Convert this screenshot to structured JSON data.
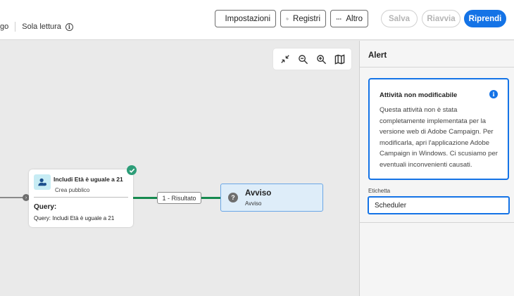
{
  "header": {
    "left_fragment": "go",
    "read_only_label": "Sola lettura",
    "info_icon": "info-icon",
    "settings_label": "Impostazioni",
    "logs_label": "Registri",
    "more_label": "Altro",
    "save_label": "Salva",
    "restart_label": "Riavvia",
    "resume_label": "Riprendi"
  },
  "zoom_toolbar": {
    "icons": [
      "collapse-icon",
      "zoom-out-icon",
      "zoom-in-icon",
      "map-icon"
    ]
  },
  "workflow": {
    "audience_node": {
      "title": "Includi Età è uguale a 21",
      "subtitle": "Crea pubblico",
      "query_label": "Query:",
      "query_prefix": "Query:",
      "query_value": "Includi Età è uguale a 21",
      "status": "completed"
    },
    "transition_label": "1 -  Risultato",
    "alert_node": {
      "title": "Avviso",
      "subtitle": "Avviso"
    }
  },
  "panel": {
    "title": "Alert",
    "notice_title": "Attività non modificabile",
    "notice_body": "Questa attività non è stata completamente implementata per la versione web di Adobe Campaign. Per modificarla, apri l'applicazione Adobe Campaign in Windows. Ci scusiamo per eventuali inconvenienti causati.",
    "label_field_label": "Etichetta",
    "label_field_value": "Scheduler"
  },
  "colors": {
    "accent": "#1473e6",
    "success": "#2d9d78",
    "link_line": "#168a4f",
    "alert_node_bg": "#deedf9"
  }
}
